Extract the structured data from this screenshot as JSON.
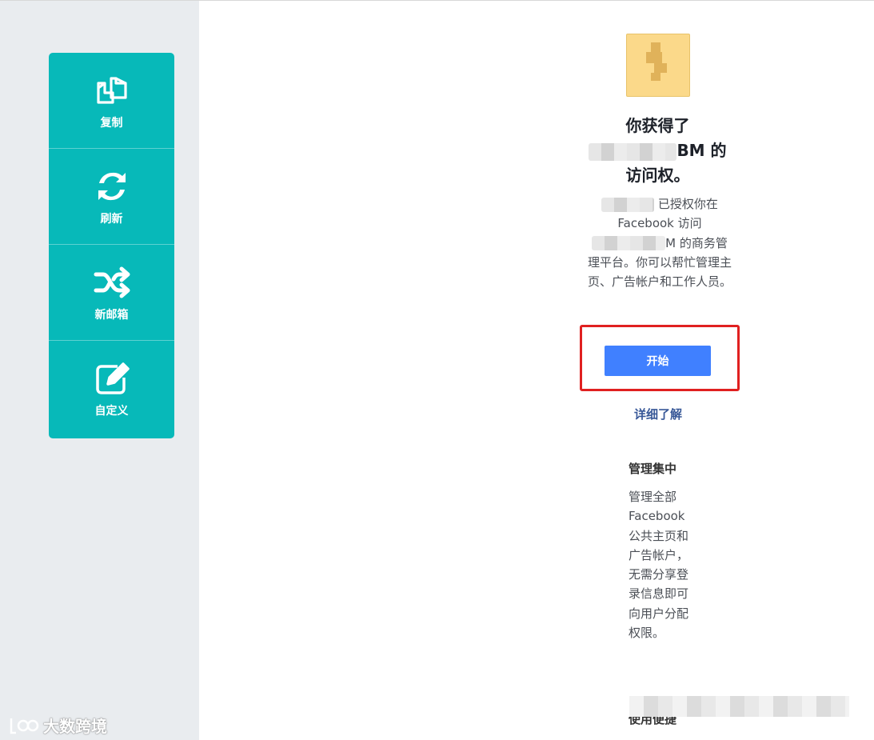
{
  "sidebar": {
    "tools": [
      {
        "label": "复制",
        "icon": "copy-icon"
      },
      {
        "label": "刷新",
        "icon": "refresh-icon"
      },
      {
        "label": "新邮箱",
        "icon": "shuffle-icon"
      },
      {
        "label": "自定义",
        "icon": "edit-icon"
      }
    ],
    "watermark": "大数跨境"
  },
  "colors": {
    "tool_bg": "#07b9b9",
    "primary_button": "#4080ff",
    "link": "#385898",
    "highlight_border": "#e02020",
    "sidebar_bg": "#e9ecef"
  },
  "invite": {
    "title_line1": "你获得了",
    "title_line2_suffix": "BM 的",
    "title_line3": "访问权。",
    "desc_part1": "已授权你在",
    "desc_part2": "Facebook 访问",
    "desc_part3": "M 的商务管",
    "desc_part4": "理平台。你可以帮忙管理主页、广告帐户和工作人员。",
    "start_button": "开始",
    "learn_more": "详细了解"
  },
  "feature": {
    "title": "管理集中",
    "body": "管理全部Facebook公共主页和广告帐户，无需分享登录信息即可向用户分配权限。"
  },
  "footer": {
    "partial_heading": "使用便捷"
  }
}
